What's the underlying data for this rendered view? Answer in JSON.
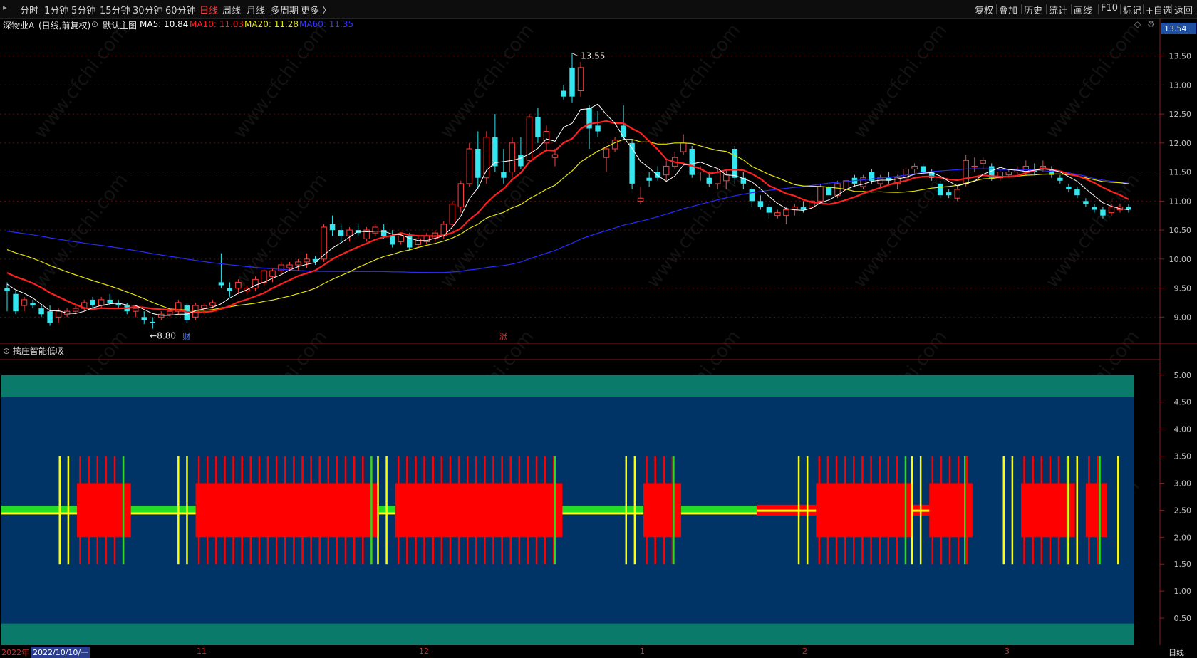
{
  "toolbar": {
    "left_items": [
      {
        "label": "分时",
        "active": false
      },
      {
        "label": "1分钟",
        "active": false
      },
      {
        "label": "5分钟",
        "active": false
      },
      {
        "label": "15分钟",
        "active": false
      },
      {
        "label": "30分钟",
        "active": false
      },
      {
        "label": "60分钟",
        "active": false
      },
      {
        "label": "日线",
        "active": true
      },
      {
        "label": "周线",
        "active": false
      },
      {
        "label": "月线",
        "active": false
      },
      {
        "label": "多周期",
        "active": false
      },
      {
        "label": "更多 〉",
        "active": false
      }
    ],
    "right_items": [
      "复权",
      "叠加",
      "历史",
      "统计",
      "画线",
      "F10",
      "标记",
      "+自选",
      "返回"
    ]
  },
  "infobar": {
    "stock_name": "深物业A",
    "mode": "(日线,前复权)",
    "main_chart_label": "默认主图",
    "ma5": "MA5: 10.84",
    "ma10": "MA10: 11.03",
    "ma20": "MA20: 11.28",
    "ma60": "MA60: 11.35",
    "price_tag": "13.54",
    "colors": {
      "ma5": "#ffffff",
      "ma10": "#ff2020",
      "ma20": "#e6e600",
      "ma60": "#2a2aff"
    }
  },
  "annotations": {
    "high_label": "13.55",
    "low_label": "←8.80",
    "marker_cai": "财",
    "marker_zhang": "涨"
  },
  "indicator": {
    "title": "擒庄智能低吸",
    "y_ticks": [
      "5.00",
      "4.50",
      "4.00",
      "3.50",
      "3.00",
      "2.50",
      "2.00",
      "1.50",
      "1.00",
      "0.50"
    ],
    "colors": {
      "band": "#0a7a6a",
      "background": "#003366",
      "bar": "#ff0000",
      "green": "#22dd22",
      "yellow": "#ffff00"
    }
  },
  "bottom": {
    "year": "2022年",
    "date_cursor": "2022/10/10/一",
    "months": [
      "11",
      "12",
      "1",
      "2",
      "3"
    ],
    "period_label": "日线"
  },
  "watermark": "www.cfchi.com",
  "chart_data": {
    "type": "candlestick",
    "y_ticks": [
      "13.50",
      "13.00",
      "12.50",
      "12.00",
      "11.50",
      "11.00",
      "10.50",
      "10.00",
      "9.50",
      "9.00"
    ],
    "ylim": [
      8.55,
      13.9
    ],
    "high_value": 13.55,
    "low_value": 8.8,
    "candles": [
      [
        9.5,
        9.6,
        9.1,
        9.45
      ],
      [
        9.4,
        9.45,
        9.05,
        9.1
      ],
      [
        9.2,
        9.35,
        9.1,
        9.3
      ],
      [
        9.25,
        9.3,
        9.15,
        9.2
      ],
      [
        9.15,
        9.2,
        9.0,
        9.05
      ],
      [
        9.1,
        9.2,
        8.85,
        8.9
      ],
      [
        9.0,
        9.15,
        8.9,
        9.1
      ],
      [
        9.05,
        9.15,
        9.0,
        9.1
      ],
      [
        9.1,
        9.2,
        9.05,
        9.15
      ],
      [
        9.15,
        9.3,
        9.1,
        9.25
      ],
      [
        9.3,
        9.35,
        9.15,
        9.2
      ],
      [
        9.2,
        9.35,
        9.15,
        9.3
      ],
      [
        9.3,
        9.4,
        9.2,
        9.25
      ],
      [
        9.25,
        9.3,
        9.15,
        9.2
      ],
      [
        9.2,
        9.25,
        9.05,
        9.1
      ],
      [
        9.1,
        9.2,
        9.0,
        9.15
      ],
      [
        9.0,
        9.1,
        8.88,
        8.95
      ],
      [
        8.92,
        9.0,
        8.8,
        8.9
      ],
      [
        9.0,
        9.1,
        8.95,
        9.05
      ],
      [
        9.05,
        9.15,
        9.0,
        9.1
      ],
      [
        9.1,
        9.3,
        9.05,
        9.25
      ],
      [
        9.2,
        9.25,
        8.9,
        8.95
      ],
      [
        9.0,
        9.25,
        8.95,
        9.2
      ],
      [
        9.15,
        9.25,
        9.05,
        9.2
      ],
      [
        9.2,
        9.3,
        9.15,
        9.25
      ],
      [
        9.6,
        10.1,
        9.5,
        9.55
      ],
      [
        9.5,
        9.6,
        9.35,
        9.45
      ],
      [
        9.5,
        9.65,
        9.4,
        9.6
      ],
      [
        9.45,
        9.55,
        9.4,
        9.5
      ],
      [
        9.5,
        9.7,
        9.45,
        9.65
      ],
      [
        9.6,
        9.85,
        9.55,
        9.8
      ],
      [
        9.7,
        9.85,
        9.6,
        9.8
      ],
      [
        9.8,
        9.95,
        9.75,
        9.9
      ],
      [
        9.85,
        9.95,
        9.8,
        9.9
      ],
      [
        9.9,
        10.0,
        9.8,
        9.95
      ],
      [
        9.95,
        10.1,
        9.85,
        10.0
      ],
      [
        10.0,
        10.05,
        9.9,
        9.95
      ],
      [
        10.0,
        10.6,
        9.95,
        10.55
      ],
      [
        10.6,
        10.75,
        10.4,
        10.5
      ],
      [
        10.5,
        10.6,
        10.3,
        10.4
      ],
      [
        10.4,
        10.55,
        10.3,
        10.5
      ],
      [
        10.5,
        10.6,
        10.4,
        10.45
      ],
      [
        10.35,
        10.55,
        10.3,
        10.5
      ],
      [
        10.45,
        10.6,
        10.4,
        10.55
      ],
      [
        10.5,
        10.6,
        10.35,
        10.4
      ],
      [
        10.4,
        10.5,
        10.2,
        10.25
      ],
      [
        10.3,
        10.45,
        10.25,
        10.4
      ],
      [
        10.4,
        10.45,
        10.15,
        10.2
      ],
      [
        10.25,
        10.4,
        10.2,
        10.35
      ],
      [
        10.3,
        10.45,
        10.25,
        10.4
      ],
      [
        10.35,
        10.5,
        10.3,
        10.45
      ],
      [
        10.4,
        10.65,
        10.35,
        10.6
      ],
      [
        10.6,
        11.0,
        10.55,
        10.95
      ],
      [
        10.9,
        11.35,
        10.8,
        11.3
      ],
      [
        11.3,
        12.0,
        11.25,
        11.9
      ],
      [
        11.9,
        12.2,
        11.2,
        11.4
      ],
      [
        11.4,
        12.2,
        11.3,
        12.1
      ],
      [
        12.1,
        12.5,
        11.5,
        11.6
      ],
      [
        11.5,
        11.9,
        11.3,
        11.4
      ],
      [
        11.5,
        12.1,
        11.4,
        12.0
      ],
      [
        11.8,
        12.1,
        11.55,
        11.6
      ],
      [
        11.7,
        12.5,
        11.65,
        12.45
      ],
      [
        12.45,
        12.6,
        12.0,
        12.1
      ],
      [
        12.0,
        12.3,
        11.85,
        12.2
      ],
      [
        11.75,
        11.9,
        11.6,
        11.8
      ],
      [
        12.9,
        13.0,
        12.75,
        12.8
      ],
      [
        13.3,
        13.55,
        12.7,
        12.8
      ],
      [
        12.9,
        13.4,
        12.8,
        13.3
      ],
      [
        12.6,
        12.65,
        11.9,
        12.25
      ],
      [
        12.3,
        12.55,
        12.1,
        12.2
      ],
      [
        11.75,
        11.95,
        11.5,
        11.9
      ],
      [
        11.9,
        12.1,
        11.85,
        12.05
      ],
      [
        12.3,
        12.65,
        12.05,
        12.1
      ],
      [
        12.0,
        12.05,
        11.2,
        11.3
      ],
      [
        11.0,
        11.25,
        10.95,
        11.05
      ],
      [
        11.4,
        11.5,
        11.25,
        11.35
      ],
      [
        11.5,
        11.6,
        11.35,
        11.4
      ],
      [
        11.45,
        11.7,
        11.35,
        11.6
      ],
      [
        11.6,
        11.85,
        11.55,
        11.75
      ],
      [
        11.85,
        12.15,
        11.8,
        12.0
      ],
      [
        11.9,
        11.95,
        11.4,
        11.45
      ],
      [
        11.5,
        11.6,
        11.35,
        11.55
      ],
      [
        11.4,
        11.5,
        11.25,
        11.3
      ],
      [
        11.3,
        11.55,
        11.2,
        11.5
      ],
      [
        11.35,
        11.55,
        11.2,
        11.45
      ],
      [
        11.9,
        11.95,
        11.3,
        11.4
      ],
      [
        11.4,
        11.5,
        11.2,
        11.3
      ],
      [
        11.2,
        11.25,
        10.9,
        11.0
      ],
      [
        11.0,
        11.1,
        10.85,
        10.9
      ],
      [
        10.9,
        10.95,
        10.7,
        10.8
      ],
      [
        10.75,
        10.85,
        10.7,
        10.8
      ],
      [
        10.75,
        10.9,
        10.6,
        10.85
      ],
      [
        10.85,
        10.95,
        10.75,
        10.9
      ],
      [
        10.9,
        11.0,
        10.8,
        10.85
      ],
      [
        10.9,
        11.05,
        10.85,
        11.0
      ],
      [
        11.0,
        11.3,
        10.95,
        11.25
      ],
      [
        11.25,
        11.3,
        11.05,
        11.1
      ],
      [
        11.1,
        11.35,
        11.05,
        11.3
      ],
      [
        11.2,
        11.4,
        11.15,
        11.35
      ],
      [
        11.4,
        11.45,
        11.25,
        11.3
      ],
      [
        11.25,
        11.45,
        11.2,
        11.4
      ],
      [
        11.5,
        11.55,
        11.3,
        11.35
      ],
      [
        11.3,
        11.45,
        11.25,
        11.4
      ],
      [
        11.4,
        11.5,
        11.3,
        11.35
      ],
      [
        11.3,
        11.45,
        11.2,
        11.4
      ],
      [
        11.4,
        11.6,
        11.35,
        11.55
      ],
      [
        11.55,
        11.65,
        11.45,
        11.6
      ],
      [
        11.6,
        11.65,
        11.45,
        11.5
      ],
      [
        11.5,
        11.55,
        11.35,
        11.4
      ],
      [
        11.3,
        11.35,
        11.05,
        11.1
      ],
      [
        11.15,
        11.2,
        11.05,
        11.1
      ],
      [
        11.05,
        11.25,
        11.0,
        11.2
      ],
      [
        11.3,
        11.8,
        11.25,
        11.7
      ],
      [
        11.6,
        11.75,
        11.5,
        11.6
      ],
      [
        11.65,
        11.75,
        11.55,
        11.7
      ],
      [
        11.6,
        11.65,
        11.35,
        11.4
      ],
      [
        11.4,
        11.55,
        11.35,
        11.5
      ],
      [
        11.45,
        11.55,
        11.4,
        11.5
      ],
      [
        11.5,
        11.6,
        11.45,
        11.55
      ],
      [
        11.5,
        11.7,
        11.45,
        11.6
      ],
      [
        11.55,
        11.65,
        11.45,
        11.5
      ],
      [
        11.55,
        11.7,
        11.5,
        11.6
      ],
      [
        11.55,
        11.6,
        11.4,
        11.45
      ],
      [
        11.4,
        11.45,
        11.3,
        11.35
      ],
      [
        11.25,
        11.3,
        11.15,
        11.2
      ],
      [
        11.2,
        11.25,
        11.05,
        11.1
      ],
      [
        11.0,
        11.05,
        10.9,
        10.95
      ],
      [
        10.9,
        10.95,
        10.8,
        10.85
      ],
      [
        10.85,
        10.9,
        10.7,
        10.75
      ],
      [
        10.8,
        10.95,
        10.75,
        10.9
      ],
      [
        10.85,
        10.95,
        10.8,
        10.9
      ],
      [
        10.9,
        10.95,
        10.8,
        10.85
      ]
    ],
    "indicator_segments": [
      {
        "start": 0,
        "end": 80,
        "base": "green"
      },
      {
        "start": 80,
        "end": 101,
        "base": "red"
      },
      {
        "start": 101,
        "end": 140,
        "base": "green"
      },
      {
        "start": 140,
        "end": 175,
        "base": "red"
      }
    ],
    "indicator_blocks": [
      {
        "start": 14,
        "end": 24,
        "low": 2.0,
        "high": 3.0
      },
      {
        "start": 36,
        "end": 70,
        "low": 2.0,
        "high": 3.0
      },
      {
        "start": 73,
        "end": 104,
        "low": 2.0,
        "high": 3.0
      },
      {
        "start": 119,
        "end": 126,
        "low": 2.0,
        "high": 3.0
      },
      {
        "start": 151,
        "end": 169,
        "low": 2.0,
        "high": 3.0
      },
      {
        "start": 172,
        "end": 180,
        "low": 2.0,
        "high": 3.0
      },
      {
        "start": 189,
        "end": 199,
        "low": 2.0,
        "high": 3.0
      },
      {
        "start": 201,
        "end": 205,
        "low": 2.0,
        "high": 3.0
      }
    ]
  }
}
